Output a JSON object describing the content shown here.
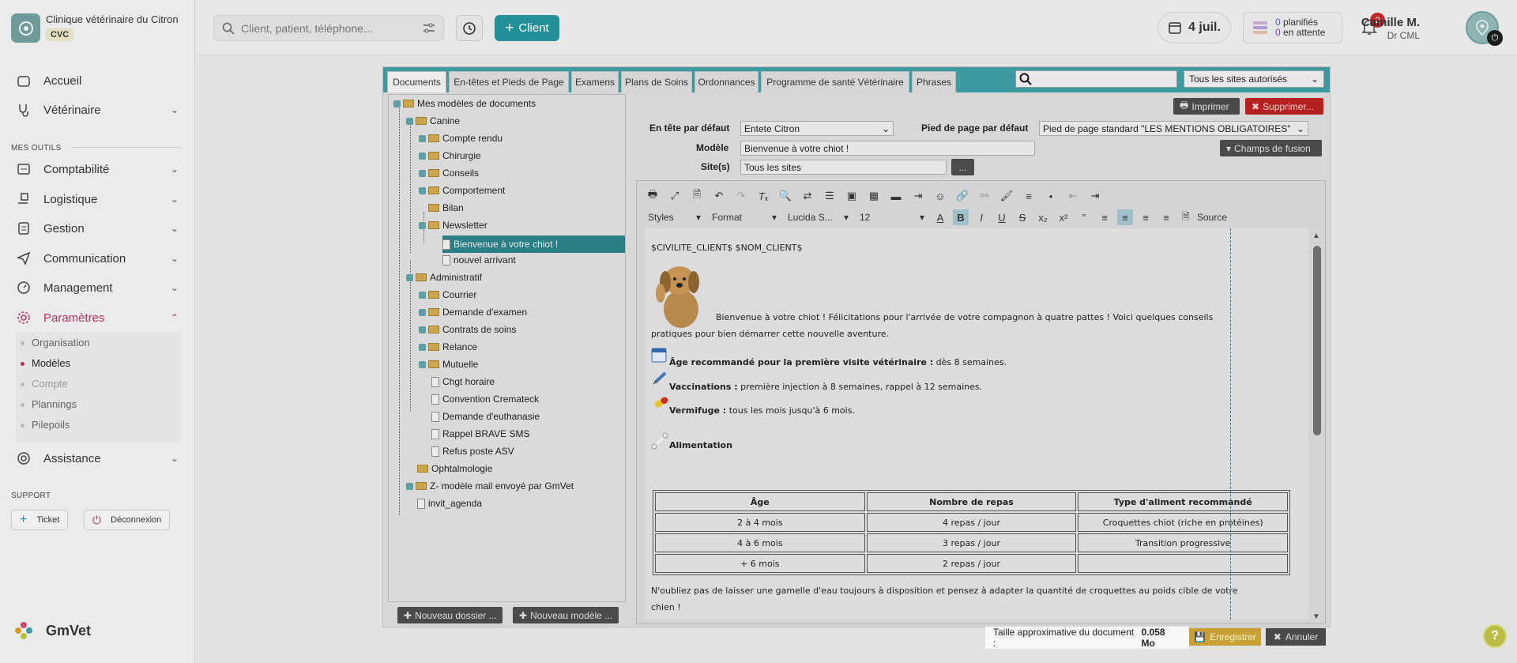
{
  "clinic": {
    "name": "Clinique vétérinaire du Citron",
    "tag": "CVC"
  },
  "nav": {
    "accueil": "Accueil",
    "veterinaire": "Vétérinaire",
    "mes_outils": "MES OUTILS",
    "comptabilite": "Comptabilité",
    "logistique": "Logistique",
    "gestion": "Gestion",
    "communication": "Communication",
    "management": "Management",
    "parametres": "Paramètres",
    "sub": [
      "Organisation",
      "Modèles",
      "Compte",
      "Plannings",
      "Pilepoils"
    ],
    "assistance": "Assistance",
    "support": "SUPPORT",
    "ticket": "Ticket",
    "deconnexion": "Déconnexion",
    "brand": "GmVet"
  },
  "header": {
    "search_placeholder": "Client, patient, téléphone...",
    "add_client": "Client",
    "date": "4 juil.",
    "planned_count": "0",
    "planned_label": "planifiés",
    "pending_count": "0",
    "pending_label": "en attente",
    "notif_count": "2",
    "user_name": "Camille M.",
    "user_role": "Dr CML"
  },
  "tabs": [
    "Documents",
    "En-têtes et Pieds de Page",
    "Examens",
    "Plans de Soins",
    "Ordonnances",
    "Programme de santé Vétérinaire",
    "Phrases"
  ],
  "site_filter": "Tous les sites autorisés",
  "tree": {
    "root": "Mes modèles de documents",
    "canine": "Canine",
    "compte_rendu": "Compte rendu",
    "chirurgie": "Chirurgie",
    "conseils": "Conseils",
    "comportement": "Comportement",
    "bilan": "Bilan",
    "newsletter": "Newsletter",
    "bienvenue": "Bienvenue à votre chiot !",
    "nouvel": "nouvel arrivant",
    "administratif": "Administratif",
    "courrier": "Courrier",
    "demande_examen": "Demande d'examen",
    "contrats": "Contrats de soins",
    "relance": "Relance",
    "mutuelle": "Mutuelle",
    "chgt": "Chgt horaire",
    "convention": "Convention Cremateck",
    "euthanasie": "Demande d'euthanasie",
    "rappel": "Rappel BRAVE SMS",
    "refus": "Refus poste ASV",
    "ophtalmo": "Ophtalmologie",
    "zmodele": "Z- modèle mail envoyé par GmVet",
    "invit": "invit_agenda",
    "btn_folder": "Nouveau dossier ...",
    "btn_model": "Nouveau modèle ..."
  },
  "form": {
    "print": "Imprimer",
    "delete": "Supprimer...",
    "header_label": "En tête par défaut",
    "header_value": "Entete Citron",
    "footer_label": "Pied de page par défaut",
    "footer_value": "Pied de page standard \"LES MENTIONS OBLIGATOIRES\"",
    "model_label": "Modèle",
    "model_value": "Bienvenue à votre chiot !",
    "sites_label": "Site(s)",
    "sites_value": "Tous les sites",
    "sites_btn": "...",
    "merge_fields": "Champs de fusion"
  },
  "toolbar": {
    "styles": "Styles",
    "format": "Format",
    "font": "Lucida S...",
    "size": "12",
    "source": "Source"
  },
  "doc": {
    "merge_line": "$CIVILITE_CLIENT$ $NOM_CLIENT$",
    "intro1": "Bienvenue à votre chiot ! Félicitations pour l'arrivée de votre compagnon à quatre pattes ! Voici quelques conseils",
    "intro2": "pratiques pour bien démarrer cette nouvelle aventure.",
    "age_b": "Âge recommandé pour la première visite vétérinaire :",
    "age_t": " dès 8 semaines.",
    "vacc_b": "Vaccinations :",
    "vacc_t": " première injection à 8 semaines, rappel à 12 semaines.",
    "verm_b": "Vermifuge :",
    "verm_t": " tous les mois jusqu'à 6 mois.",
    "alim": "Alimentation",
    "table_headers": [
      "Âge",
      "Nombre de repas",
      "Type d'aliment recommandé"
    ],
    "table_rows": [
      [
        "2 à 4 mois",
        "4 repas / jour",
        "Croquettes chiot (riche en protéines)"
      ],
      [
        "4 à 6 mois",
        "3 repas / jour",
        "Transition progressive"
      ],
      [
        "+ 6 mois",
        "2 repas / jour",
        ""
      ]
    ],
    "outro1": "N'oubliez pas de laisser une gamelle d'eau toujours à disposition et pensez à adapter la quantité de croquettes au poids cible de votre",
    "outro2": "chien !"
  },
  "footer": {
    "size_label": "Taille approximative du document :",
    "size_value": "0.058 Mo",
    "save": "Enregistrer",
    "cancel": "Annuler"
  }
}
